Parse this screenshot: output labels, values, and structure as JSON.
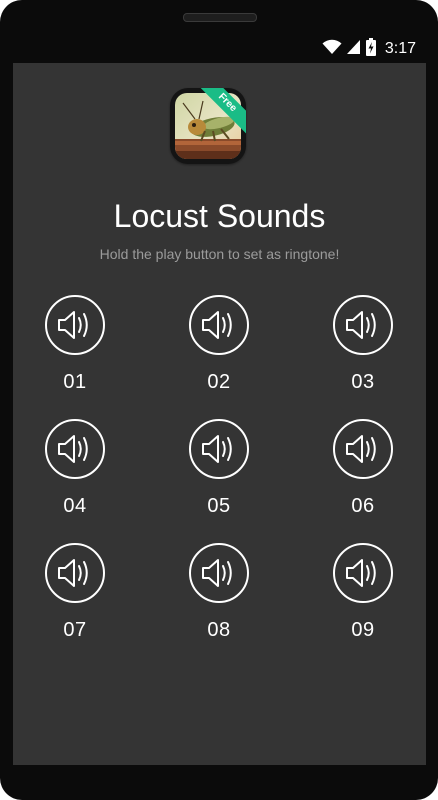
{
  "status_bar": {
    "time": "3:17",
    "icons": [
      "wifi-icon",
      "signal-icon",
      "battery-charging-icon"
    ]
  },
  "app": {
    "icon_badge": "Free",
    "title": "Locust Sounds",
    "subtitle": "Hold the play button to set as ringtone!"
  },
  "sounds": [
    {
      "label": "01",
      "icon": "speaker-icon"
    },
    {
      "label": "02",
      "icon": "speaker-icon"
    },
    {
      "label": "03",
      "icon": "speaker-icon"
    },
    {
      "label": "04",
      "icon": "speaker-icon"
    },
    {
      "label": "05",
      "icon": "speaker-icon"
    },
    {
      "label": "06",
      "icon": "speaker-icon"
    },
    {
      "label": "07",
      "icon": "speaker-icon"
    },
    {
      "label": "08",
      "icon": "speaker-icon"
    },
    {
      "label": "09",
      "icon": "speaker-icon"
    }
  ],
  "colors": {
    "screen_background": "#343434",
    "badge": "#1abc86",
    "subtitle": "#9b9b9b"
  }
}
